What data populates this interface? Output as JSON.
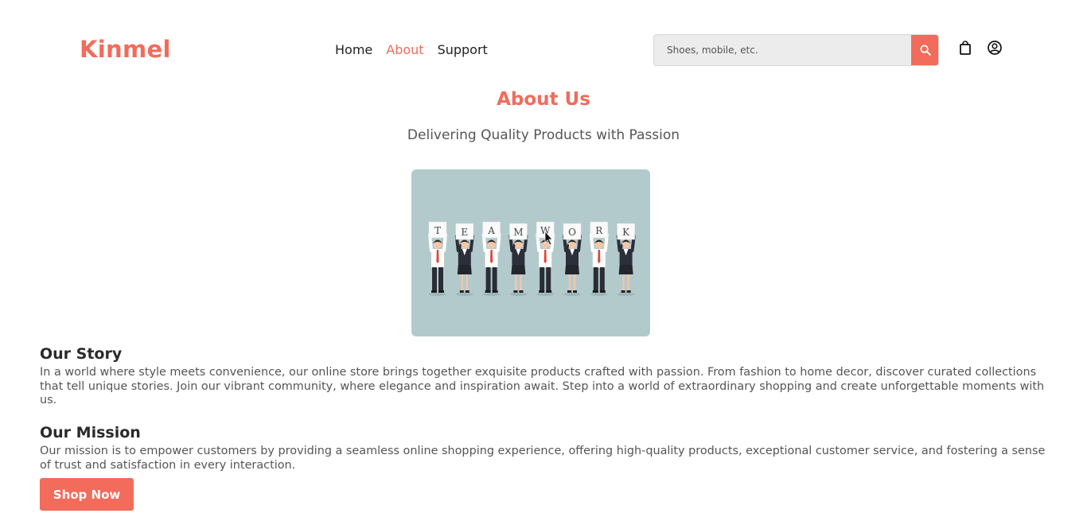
{
  "brand": {
    "name": "Kinmel",
    "accent_color": "#f26b5b"
  },
  "nav": {
    "items": [
      {
        "label": "Home",
        "active": false
      },
      {
        "label": "About",
        "active": true
      },
      {
        "label": "Support",
        "active": false
      }
    ]
  },
  "search": {
    "placeholder": "Shoes, mobile, etc.",
    "value": "",
    "button_icon": "search-icon"
  },
  "header_icons": {
    "cart": "shopping-bag-icon",
    "account": "user-circle-icon"
  },
  "page": {
    "title": "About Us",
    "subtitle": "Delivering Quality Products with Passion"
  },
  "hero_image": {
    "letters": [
      "T",
      "E",
      "A",
      "M",
      "W",
      "O",
      "R",
      "K"
    ]
  },
  "story": {
    "title": "Our Story",
    "text": "In a world where style meets convenience, our online store brings together exquisite products crafted with passion. From fashion to home decor, discover curated collections that tell unique stories. Join our vibrant community, where elegance and inspiration await. Step into a world of extraordinary shopping and create unforgettable moments with us."
  },
  "mission": {
    "title": "Our Mission",
    "text": "Our mission is to empower customers by providing a seamless online shopping experience, offering high-quality products, exceptional customer service, and fostering a sense of trust and satisfaction in every interaction."
  },
  "cta": {
    "label": "Shop Now"
  }
}
